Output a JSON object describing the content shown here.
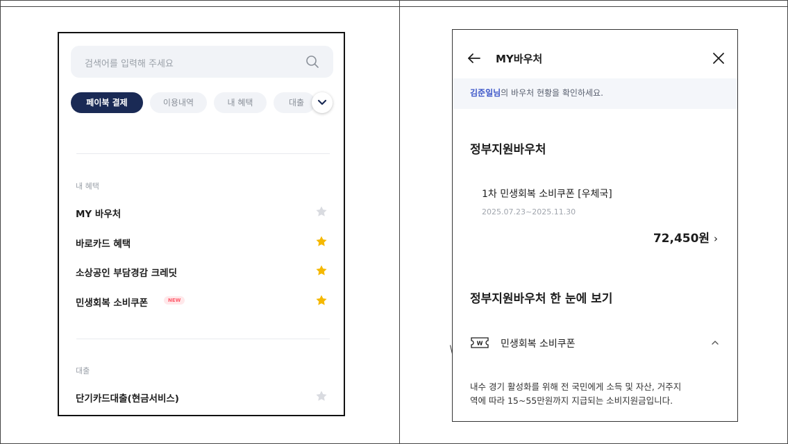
{
  "left_screen": {
    "search": {
      "placeholder": "검색어를 입력해 주세요",
      "icon": "search-icon"
    },
    "tabs": [
      {
        "label": "페이북 결제",
        "active": true
      },
      {
        "label": "이용내역",
        "active": false
      },
      {
        "label": "내 혜택",
        "active": false
      },
      {
        "label": "대출",
        "active": false
      }
    ],
    "more_tabs_icon": "chevron-down-icon",
    "sections": [
      {
        "label": "내 혜택",
        "items": [
          {
            "label": "MY 바우처",
            "favorite": false
          },
          {
            "label": "바로카드 혜택",
            "favorite": true
          },
          {
            "label": "소상공인 부담경감 크레딧",
            "favorite": true
          },
          {
            "label": "민생회복 소비쿠폰",
            "badge": "NEW",
            "favorite": true
          }
        ]
      },
      {
        "label": "대출",
        "items": [
          {
            "label": "단기카드대출(현금서비스)",
            "favorite": false
          }
        ]
      }
    ],
    "colors": {
      "active_tab": "#1a2a55",
      "star_on": "#f5b800",
      "star_off": "#d9dbe0",
      "badge": "#ff5a6a"
    }
  },
  "right_screen": {
    "header": {
      "title": "MY바우처",
      "back_icon": "arrow-left-icon",
      "close_icon": "close-icon"
    },
    "greeting": {
      "name": "김준일님",
      "text": "의 바우처 현황을 확인하세요."
    },
    "gov_voucher": {
      "title": "정부지원바우처",
      "item": {
        "name": "1차 민생회복 소비쿠폰 [우체국]",
        "period": "2025.07.23~2025.11.30",
        "amount": "72,450원",
        "chevron": "›"
      }
    },
    "overview": {
      "title": "정부지원바우처 한 눈에 보기",
      "coupon": {
        "label": "민생회복 소비쿠폰",
        "icon": "won-coupon-icon",
        "toggle_icon": "chevron-up-icon"
      },
      "description_lines": [
        "내수 경기 활성화를 위해 전 국민에게 소득 및 자산, 거주지",
        "역에 따라 15~55만원까지 지급되는 소비지원금입니다."
      ]
    },
    "colors": {
      "greeting_name": "#3b55c8",
      "greeting_bg": "#f4f6fa"
    }
  }
}
